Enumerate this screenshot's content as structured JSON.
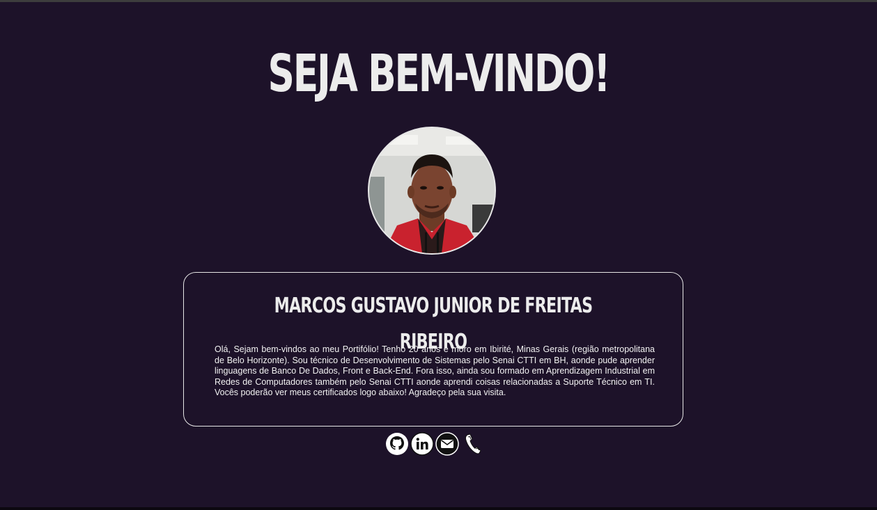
{
  "header": {
    "title": "SEJA BEM-VINDO!"
  },
  "profile": {
    "avatar_alt": "profile-photo",
    "name": "MARCOS GUSTAVO JUNIOR DE FREITAS RIBEIRO",
    "bio": "Olá, Sejam bem-vindos ao meu Portifólio! Tenho 20 anos e moro em Ibirité, Minas Gerais (região metropolitana de Belo Horizonte). Sou técnico de Desenvolvimento de Sistemas pelo Senai CTTI em BH, aonde pude aprender linguagens de Banco De Dados, Front e Back-End. Fora isso, ainda sou formado em Aprendizagem Industrial em Redes de Computadores também pelo Senai CTTI aonde aprendi coisas relacionadas a Suporte Técnico em TI. Vocês poderão ver meus certificados logo abaixo! Agradeço pela sua visita."
  },
  "socials": [
    {
      "icon": "github-icon"
    },
    {
      "icon": "linkedin-icon"
    },
    {
      "icon": "email-icon"
    },
    {
      "icon": "phone-icon"
    }
  ],
  "colors": {
    "background": "#1d1229",
    "text": "#ececec",
    "border": "#e6e6e6"
  }
}
